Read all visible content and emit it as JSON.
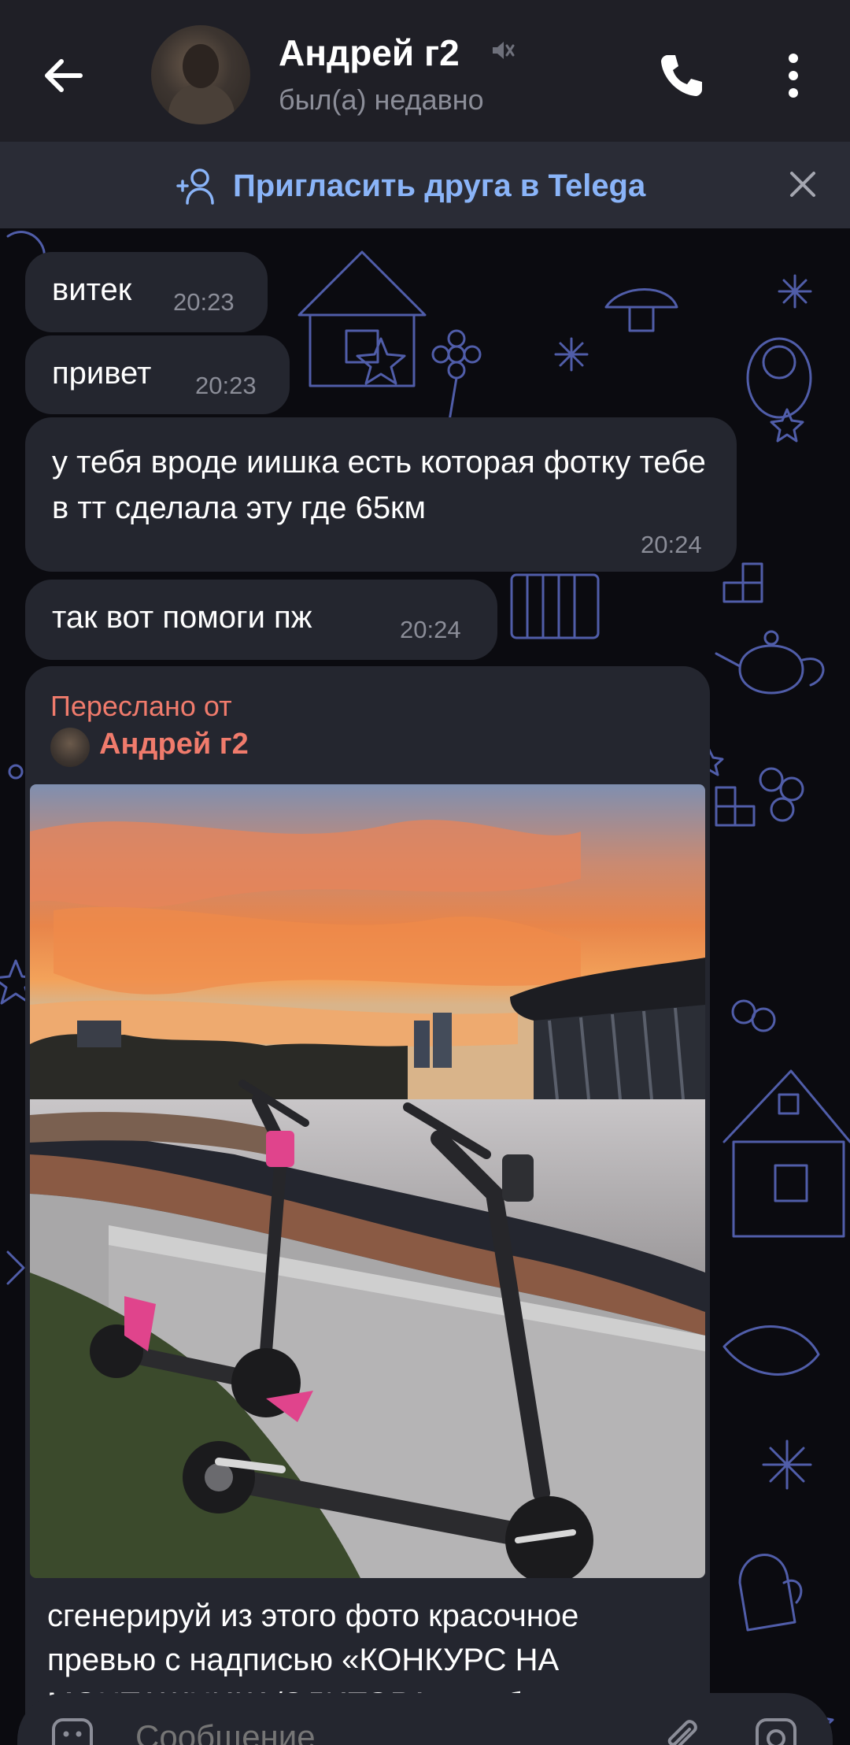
{
  "header": {
    "contact_name": "Андрей г2",
    "status": "был(а) недавно",
    "icons": [
      "back-arrow-icon",
      "mute-icon",
      "phone-icon",
      "more-vertical-icon"
    ]
  },
  "invite_bar": {
    "text": "Пригласить друга в Telega",
    "icons": [
      "add-user-icon",
      "close-icon"
    ]
  },
  "messages": [
    {
      "text": "витек",
      "time": "20:23"
    },
    {
      "text": "привет",
      "time": "20:23"
    },
    {
      "text": "у тебя вроде иишка есть которая фотку тебе в тт сделала эту где 65км",
      "time": "20:24"
    },
    {
      "text": "так вот помоги пж",
      "time": "20:24"
    }
  ],
  "forwarded": {
    "label": "Переслано от",
    "from": "Андрей г2",
    "caption": "сгенерируй из этого фото красочное превью с надписью «КОНКУРС НА МОНТАЖНИКА/ЭДИТОРА» чтобы"
  },
  "input": {
    "placeholder": "Сообщение",
    "icons": [
      "emoji-icon",
      "attach-icon",
      "camera-icon"
    ]
  },
  "colors": {
    "header_bg": "#1f1f26",
    "bubble_bg": "#24262f",
    "accent_blue": "#8ab4f8",
    "forward_accent": "#f07b6c",
    "doodle_color": "#5d6cc4"
  }
}
